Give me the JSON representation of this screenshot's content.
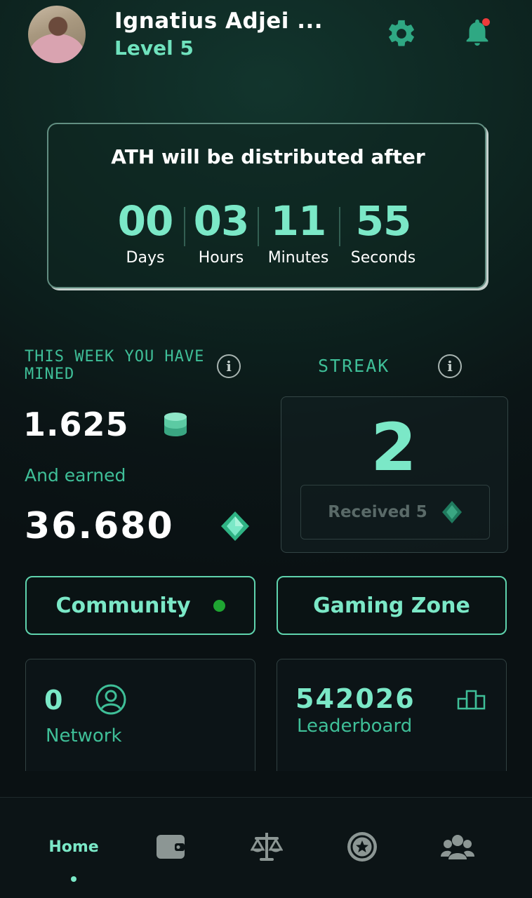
{
  "header": {
    "user_name": "Ignatius Adjei ...",
    "level": "Level 5",
    "settings_icon": "gear-icon",
    "notification_icon": "bell-icon"
  },
  "countdown": {
    "title": "ATH will be distributed after",
    "units": [
      {
        "value": "00",
        "label": "Days"
      },
      {
        "value": "03",
        "label": "Hours"
      },
      {
        "value": "11",
        "label": "Minutes"
      },
      {
        "value": "55",
        "label": "Seconds"
      }
    ]
  },
  "mined": {
    "title": "THIS WEEK YOU HAVE MINED",
    "amount": "1.625",
    "earned_label": "And earned",
    "earned_amount": "36.680"
  },
  "streak": {
    "title": "STREAK",
    "count": "2",
    "received_label": "Received 5"
  },
  "buttons": {
    "community": "Community",
    "gaming": "Gaming Zone"
  },
  "stats": {
    "network_count": "0",
    "network_label": "Network",
    "leaderboard_rank": "542026",
    "leaderboard_label": "Leaderboard"
  },
  "nav": {
    "home": "Home",
    "items": [
      "wallet-icon",
      "balance-scale-icon",
      "star-badge-icon",
      "group-icon"
    ]
  },
  "colors": {
    "accent": "#7be8c7",
    "accent_dark": "#3fbf98",
    "background": "#0b1516",
    "online": "#1fa532",
    "notification": "#ee3b3b"
  }
}
